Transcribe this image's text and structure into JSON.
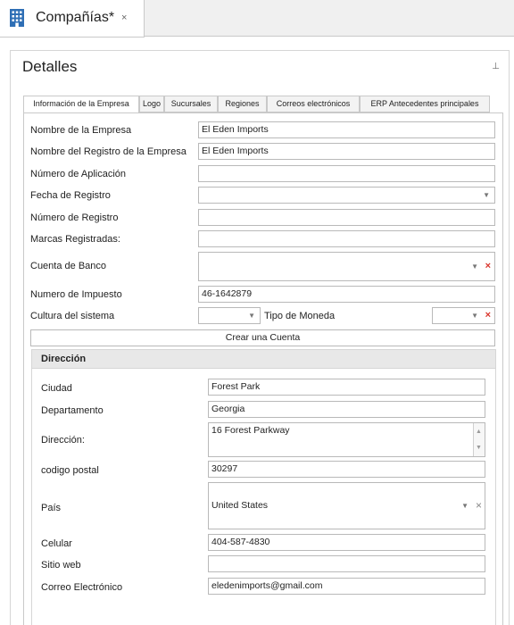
{
  "doc_tab": {
    "title": "Compañías*",
    "close_glyph": "×"
  },
  "panel": {
    "title": "Detalles",
    "pin_glyph": "⊥"
  },
  "tabs": [
    {
      "label": "Información de la Empresa"
    },
    {
      "label": "Logo"
    },
    {
      "label": "Sucursales"
    },
    {
      "label": "Regiones"
    },
    {
      "label": "Correos electrónicos"
    },
    {
      "label": "ERP Antecedentes principales"
    }
  ],
  "company": {
    "nombre_label": "Nombre de la Empresa",
    "nombre_value": "El Eden Imports",
    "registro_nombre_label": "Nombre del Registro de la Empresa",
    "registro_nombre_value": "El Eden Imports",
    "num_aplicacion_label": "Número de Aplicación",
    "num_aplicacion_value": "",
    "fecha_registro_label": "Fecha de Registro",
    "fecha_registro_value": "",
    "num_registro_label": "Número de Registro",
    "num_registro_value": "",
    "marcas_label": "Marcas Registradas:",
    "marcas_value": "",
    "cuenta_banco_label": "Cuenta de Banco",
    "cuenta_banco_value": "",
    "impuesto_label": "Numero de Impuesto",
    "impuesto_value": "46-1642879",
    "cultura_label": "Cultura del sistema",
    "cultura_value": "",
    "moneda_label": "Tipo de Moneda",
    "moneda_value": "",
    "crear_cuenta_label": "Crear una Cuenta"
  },
  "direccion": {
    "group_title": "Dirección",
    "ciudad_label": "Ciudad",
    "ciudad_value": "Forest Park",
    "departamento_label": "Departamento",
    "departamento_value": "Georgia",
    "direccion_label": "Dirección:",
    "direccion_value": "16 Forest Parkway",
    "postal_label": "codigo postal",
    "postal_value": "30297",
    "pais_label": "País",
    "pais_value": "United States",
    "celular_label": "Celular",
    "celular_value": "404-587-4830",
    "web_label": "Sitio web",
    "web_value": "",
    "correo_label": "Correo Electrónico",
    "correo_value": "eledenimports@gmail.com"
  },
  "glyphs": {
    "caret": "▼",
    "clear_red": "×",
    "clear_gray": "×",
    "scroll_up": "▲",
    "scroll_down": "▼"
  },
  "colors": {
    "clear_red": "#d9342b",
    "accent_blue": "#2f6fb5"
  }
}
